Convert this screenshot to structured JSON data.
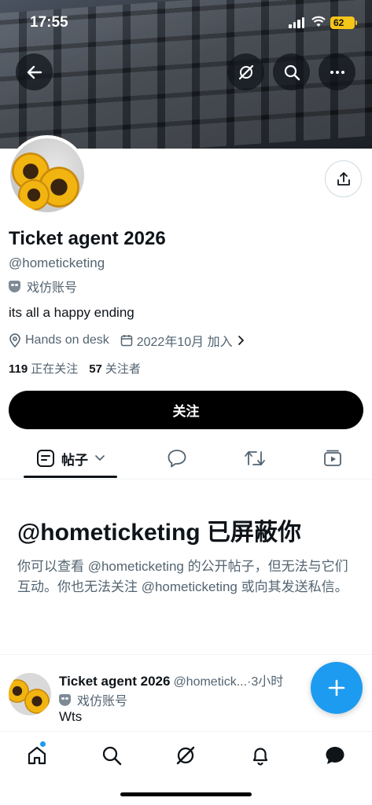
{
  "status": {
    "time": "17:55",
    "battery": "62"
  },
  "profile": {
    "name": "Ticket agent 2026",
    "handle": "@hometicketing",
    "parody_label": "戏仿账号",
    "bio": "its all a happy ending",
    "location": "Hands on desk",
    "joined": "2022年10月 加入",
    "following_count": "119",
    "following_label": "正在关注",
    "followers_count": "57",
    "followers_label": "关注者",
    "follow_button": "关注"
  },
  "tabs": {
    "posts": "帖子"
  },
  "blocked": {
    "title": "@hometicketing 已屏蔽你",
    "description": "你可以查看 @hometicketing 的公开帖子，但无法与它们互动。你也无法关注 @hometicketing 或向其发送私信。"
  },
  "post": {
    "name": "Ticket agent 2026",
    "handle_time": "@hometick...·3小时",
    "parody_label": "戏仿账号",
    "text": "Wts"
  },
  "icons": {
    "back": "arrow-left-icon",
    "grok": "grok-icon",
    "search": "search-icon",
    "more": "more-icon",
    "share": "share-icon",
    "location": "location-pin-icon",
    "calendar": "calendar-icon",
    "compose": "plus-icon"
  },
  "colors": {
    "accent": "#1d9bf0",
    "text": "#0f1419",
    "muted": "#536471"
  }
}
